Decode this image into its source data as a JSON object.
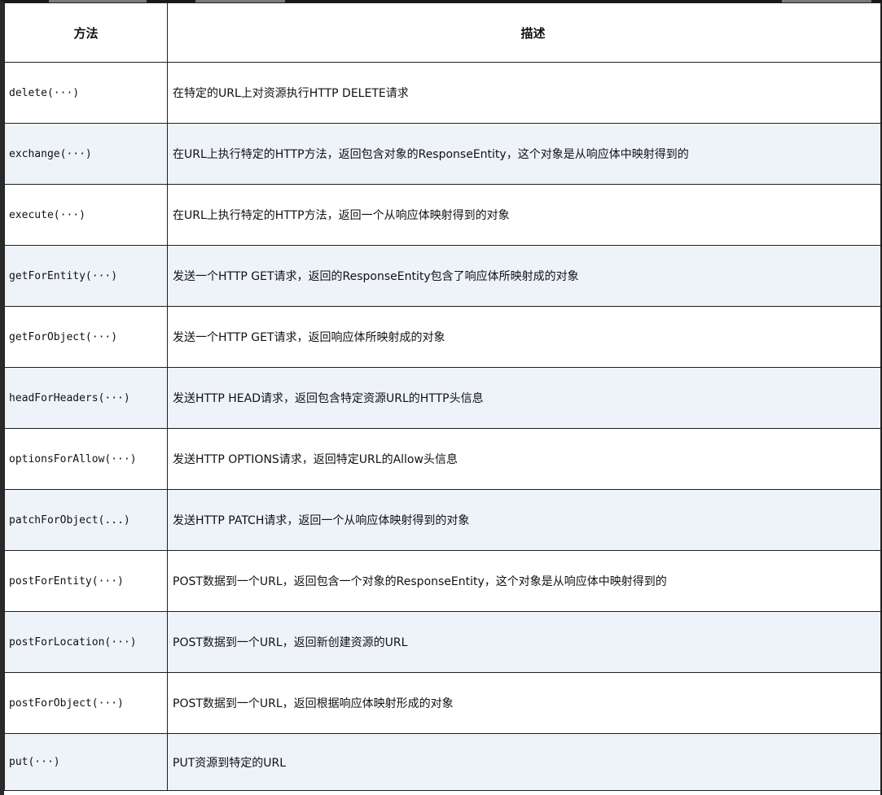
{
  "table": {
    "headers": {
      "method": "方法",
      "description": "描述"
    },
    "rows": [
      {
        "method": "delete(···)",
        "description": "在特定的URL上对资源执行HTTP DELETE请求"
      },
      {
        "method": "exchange(···)",
        "description": "在URL上执行特定的HTTP方法，返回包含对象的ResponseEntity，这个对象是从响应体中映射得到的"
      },
      {
        "method": "execute(···)",
        "description": "在URL上执行特定的HTTP方法，返回一个从响应体映射得到的对象"
      },
      {
        "method": "getForEntity(···)",
        "description": "发送一个HTTP GET请求，返回的ResponseEntity包含了响应体所映射成的对象"
      },
      {
        "method": "getForObject(···)",
        "description": "发送一个HTTP GET请求，返回响应体所映射成的对象"
      },
      {
        "method": "headForHeaders(···)",
        "description": "发送HTTP HEAD请求，返回包含特定资源URL的HTTP头信息"
      },
      {
        "method": "optionsForAllow(···)",
        "description": "发送HTTP OPTIONS请求，返回特定URL的Allow头信息"
      },
      {
        "method": "patchForObject(...)",
        "description": "发送HTTP PATCH请求，返回一个从响应体映射得到的对象"
      },
      {
        "method": "postForEntity(···)",
        "description": "POST数据到一个URL，返回包含一个对象的ResponseEntity，这个对象是从响应体中映射得到的"
      },
      {
        "method": "postForLocation(···)",
        "description": "POST数据到一个URL，返回新创建资源的URL"
      },
      {
        "method": "postForObject(···)",
        "description": "POST数据到一个URL，返回根据响应体映射形成的对象"
      },
      {
        "method": "put(···)",
        "description": "PUT资源到特定的URL"
      }
    ]
  }
}
